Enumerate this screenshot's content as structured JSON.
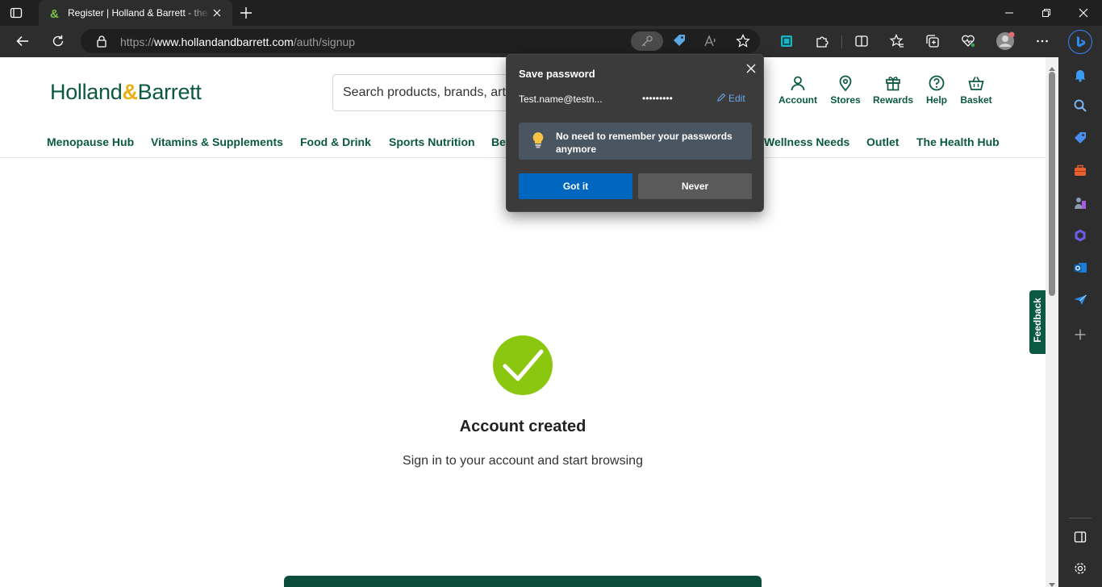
{
  "browser": {
    "tab_title": "Register | Holland & Barrett - the",
    "url_prefix": "https://",
    "url_host": "www.hollandandbarrett.com",
    "url_path": "/auth/signup"
  },
  "site": {
    "logo_left": "Holland",
    "logo_amp": "&",
    "logo_right": "Barrett",
    "search_placeholder": "Search products, brands, art",
    "header_items": [
      "Account",
      "Stores",
      "Rewards",
      "Help",
      "Basket"
    ],
    "nav": [
      "Menopause Hub",
      "Vitamins & Supplements",
      "Food & Drink",
      "Sports Nutrition",
      "Be",
      "Wellness Needs",
      "Outlet",
      "The Health Hub"
    ],
    "feedback": "Feedback"
  },
  "main": {
    "title": "Account created",
    "subtitle": "Sign in to your account and start browsing"
  },
  "popup": {
    "title": "Save password",
    "username": "Test.name@testn...",
    "password_mask": "•••••••••",
    "edit": "Edit",
    "tip": "No need to remember your passwords anymore",
    "primary": "Got it",
    "secondary": "Never"
  },
  "colors": {
    "brand_green": "#0b5942",
    "check_green": "#8cc70f",
    "accent_blue": "#0067c0"
  }
}
